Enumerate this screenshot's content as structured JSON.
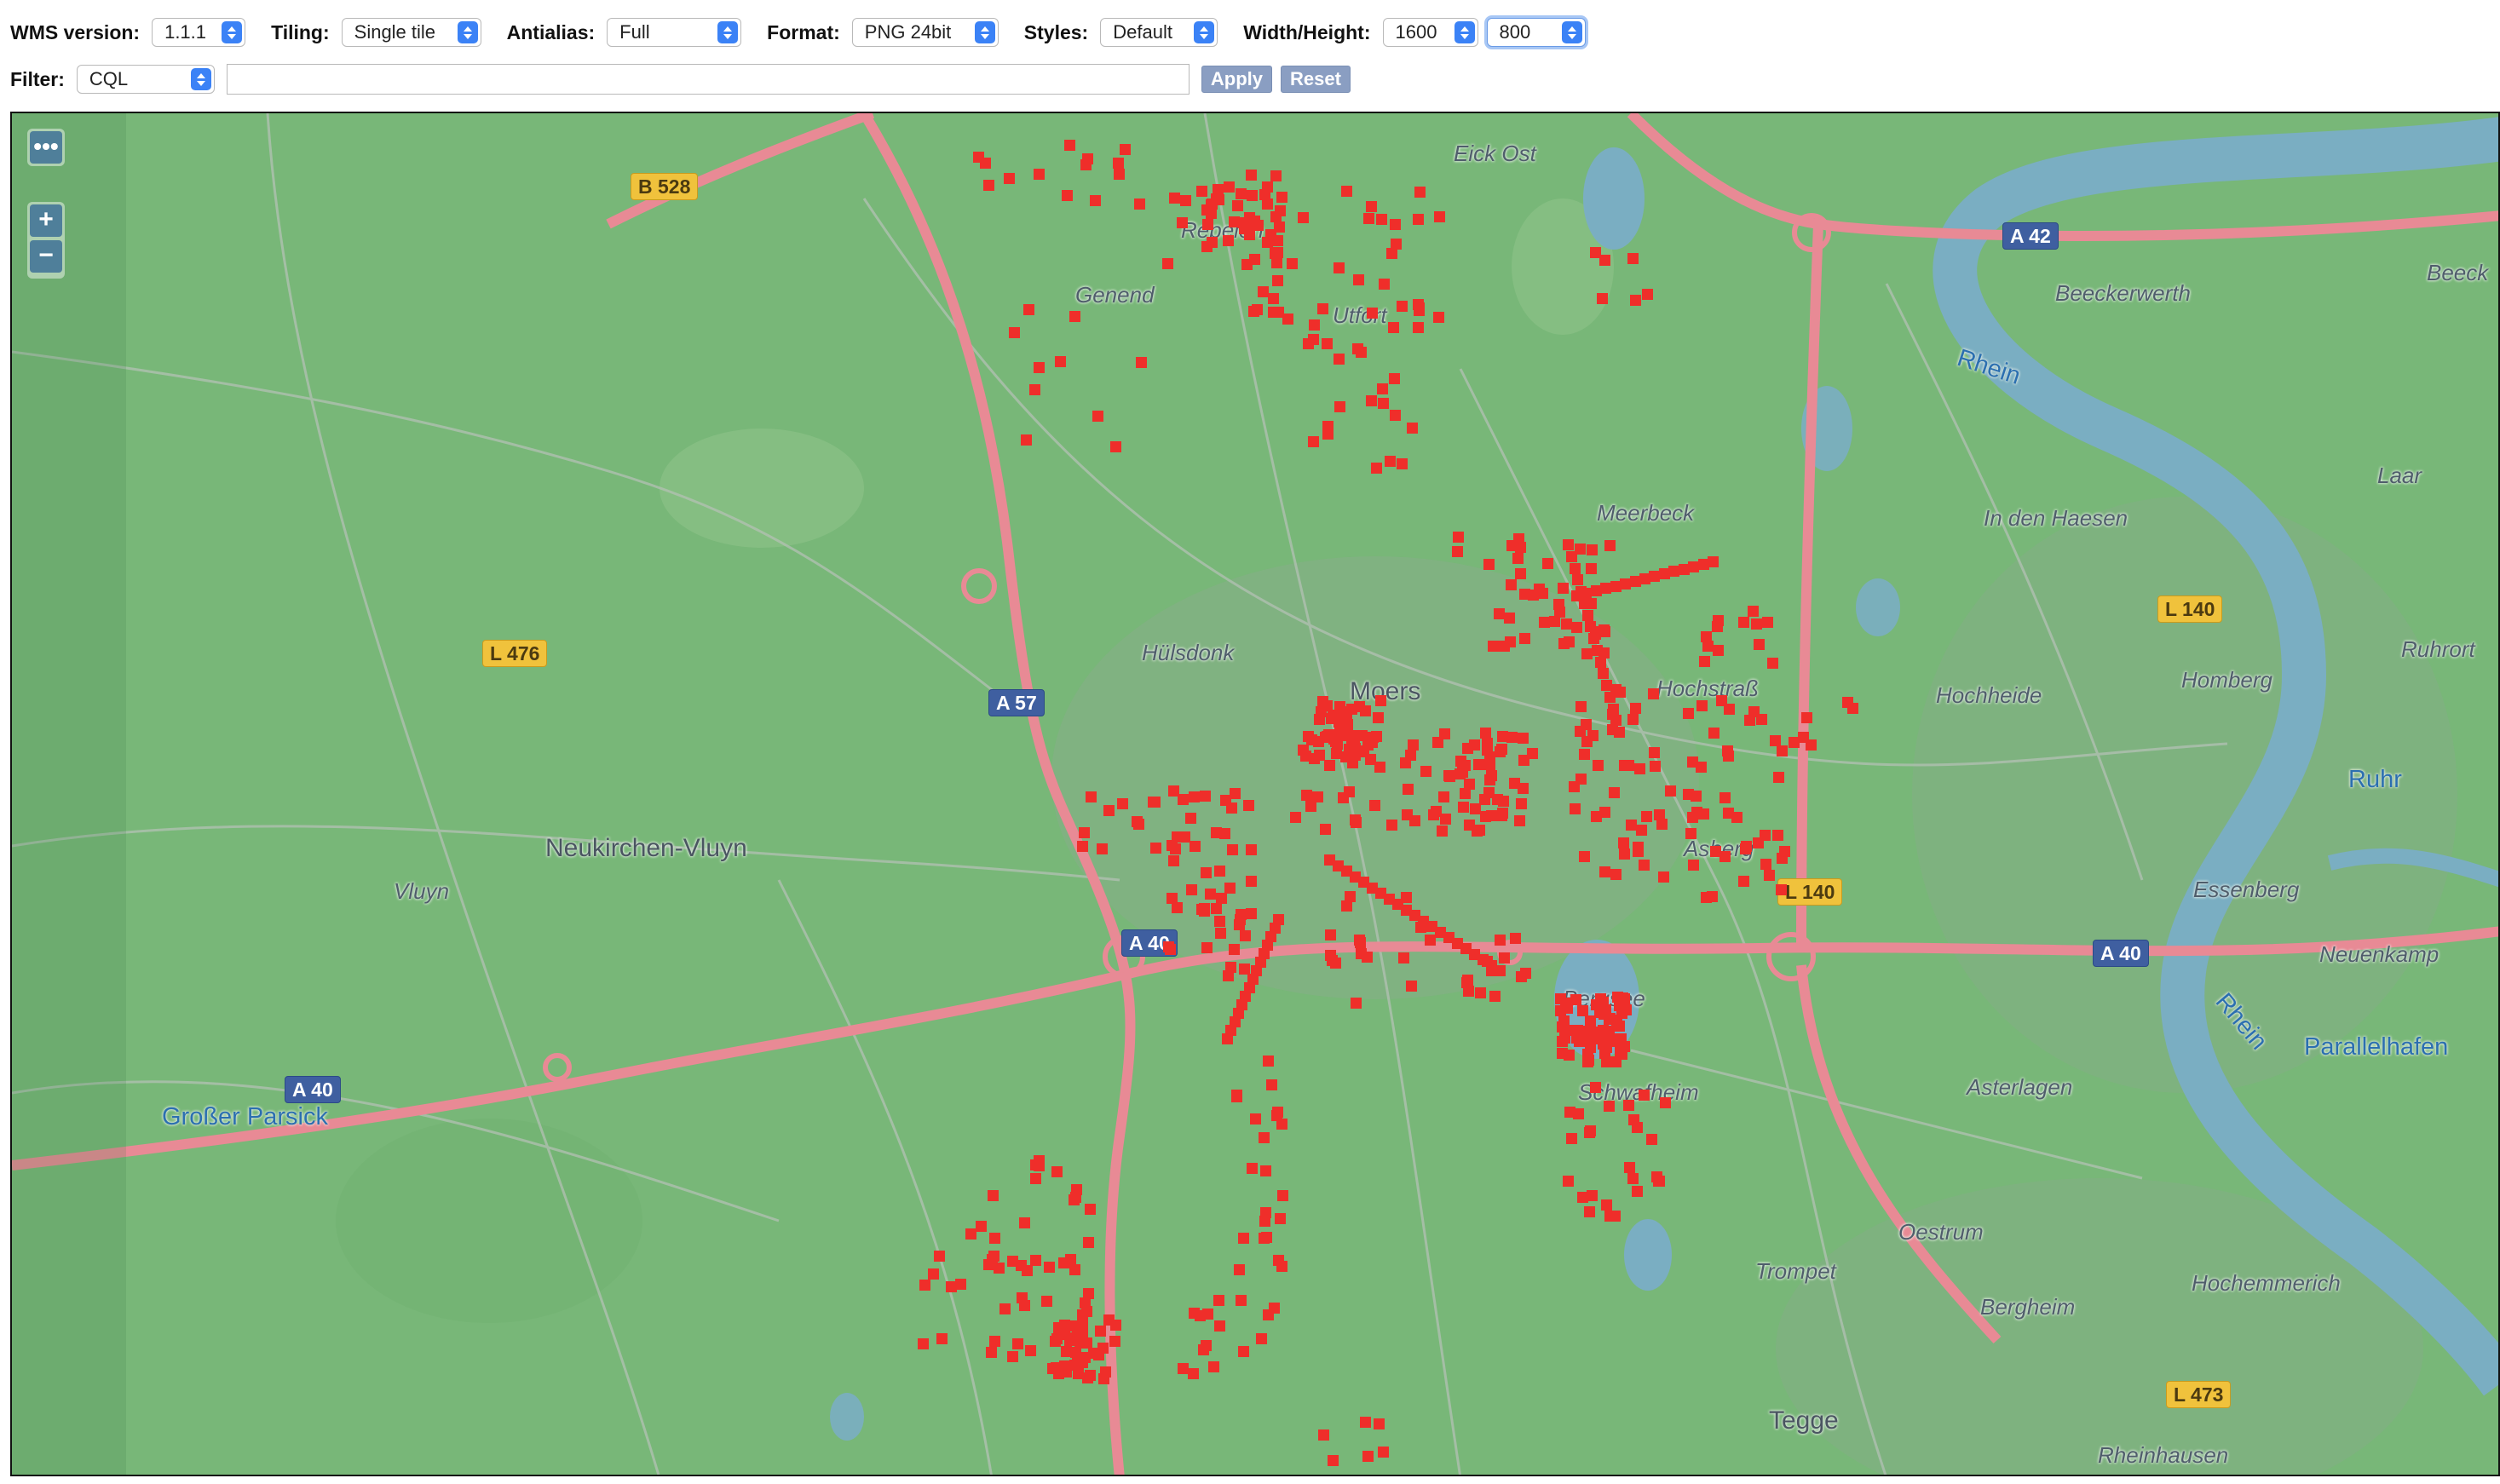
{
  "toolbar": {
    "wms_version": {
      "label": "WMS version:",
      "value": "1.1.1"
    },
    "tiling": {
      "label": "Tiling:",
      "value": "Single tile"
    },
    "antialias": {
      "label": "Antialias:",
      "value": "Full"
    },
    "format": {
      "label": "Format:",
      "value": "PNG 24bit"
    },
    "styles": {
      "label": "Styles:",
      "value": "Default"
    },
    "size": {
      "label": "Width/Height:",
      "width": "1600",
      "height": "800"
    },
    "filter": {
      "label": "Filter:",
      "type": "CQL",
      "value": ""
    },
    "apply_label": "Apply",
    "reset_label": "Reset"
  },
  "map": {
    "controls": {
      "layer_switcher": "•••",
      "zoom_in": "+",
      "zoom_out": "−"
    },
    "place_labels": [
      "Rheinhausen",
      "Tegge",
      "Bergheim",
      "Hochemmerich",
      "Trompet",
      "Oestrum",
      "Asterlagen",
      "Parallelhafen",
      "Neuenkamp",
      "Schwafheim",
      "Bergsee",
      "Essenberg",
      "Asberg",
      "Ruhrort",
      "Homberg",
      "Hochheide",
      "Hochstraß",
      "Moers",
      "Hülsdonk",
      "Meerbeck",
      "In den Haesen",
      "Laar",
      "Beeck",
      "Beeckerwerth",
      "Utfort",
      "Genend",
      "Repelen",
      "Eick Ost",
      "Vluyn",
      "Neukirchen-Vluyn",
      "Großer Parsick"
    ],
    "water_labels": [
      "Rhein",
      "Ruhr",
      "Rhein"
    ],
    "road_shields": [
      {
        "text": "B 528",
        "style": "yellow"
      },
      {
        "text": "L 476",
        "style": "yellow"
      },
      {
        "text": "A 57",
        "style": "blue"
      },
      {
        "text": "A 40",
        "style": "blue"
      },
      {
        "text": "A 40",
        "style": "blue"
      },
      {
        "text": "A 40",
        "style": "blue"
      },
      {
        "text": "A 42",
        "style": "blue"
      },
      {
        "text": "L 140",
        "style": "yellow"
      },
      {
        "text": "L 140",
        "style": "yellow"
      },
      {
        "text": "L 473",
        "style": "yellow"
      }
    ],
    "colors": {
      "land": "#78b778",
      "roads": "#e88a95",
      "water": "#7aaec2",
      "features": "#ef2e2a"
    }
  }
}
